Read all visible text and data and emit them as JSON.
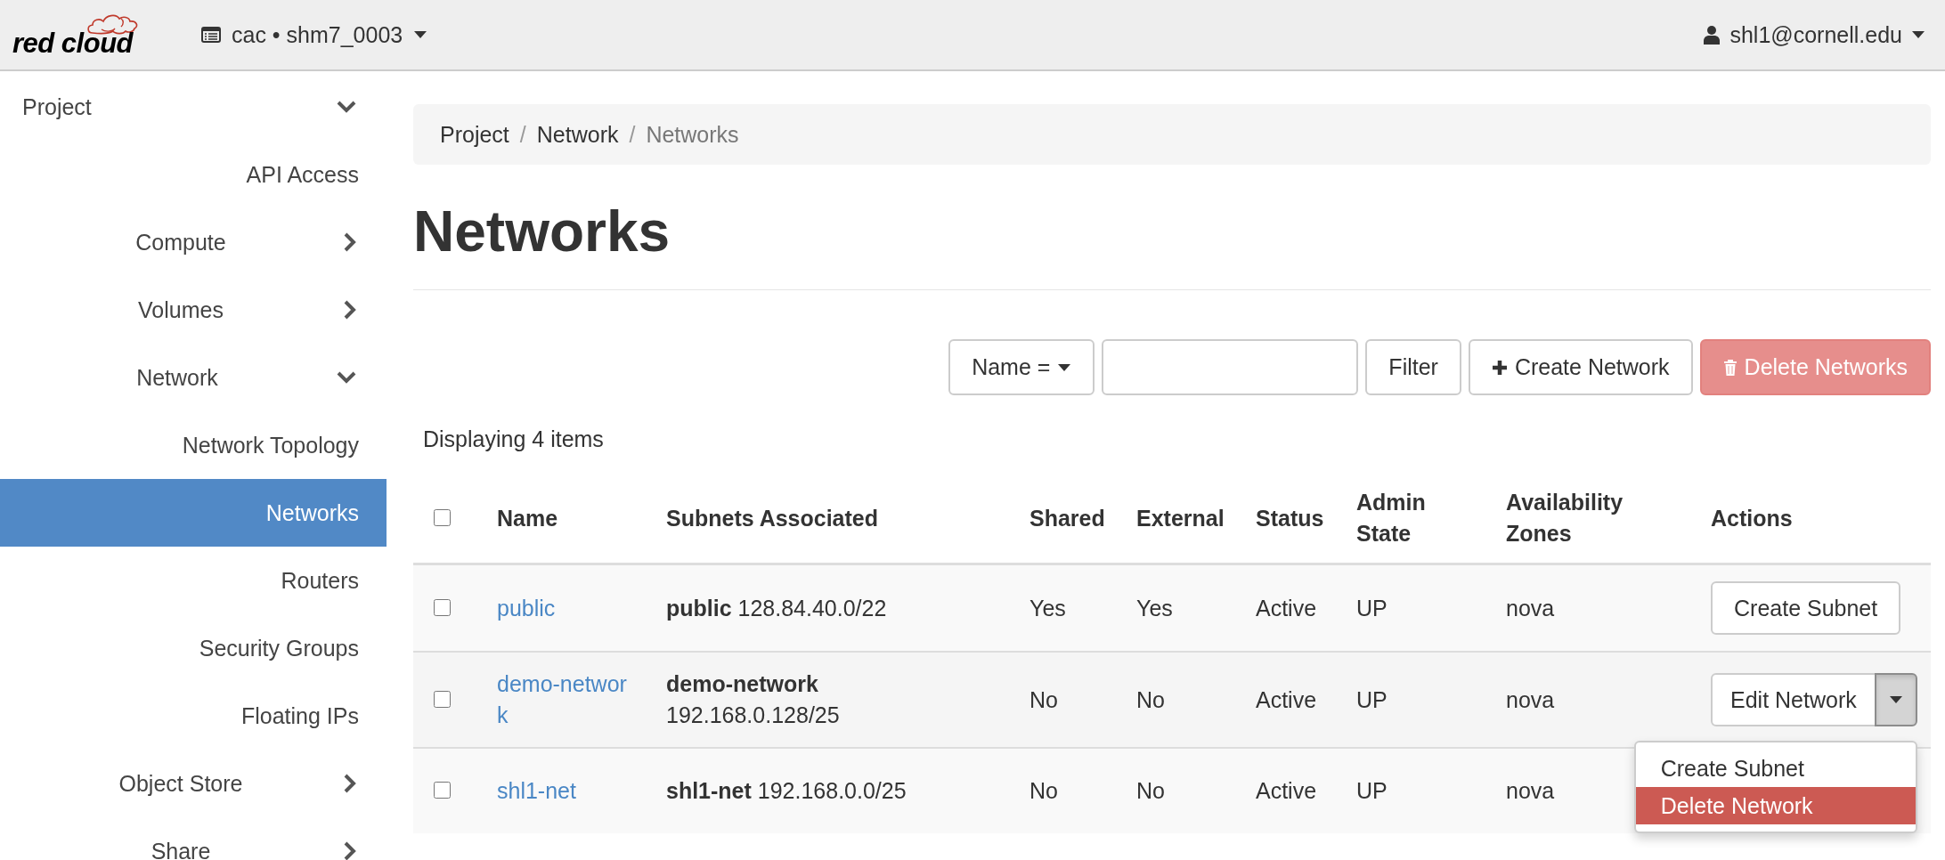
{
  "topbar": {
    "logo": "red cloud",
    "project": "cac • shm7_0003",
    "user": "shl1@cornell.edu"
  },
  "sidebar": {
    "items": [
      {
        "label": "Project",
        "kind": "section",
        "expanded": true,
        "selected": false,
        "children": [
          {
            "label": "API Access",
            "kind": "link",
            "selected": false
          },
          {
            "label": "Compute",
            "kind": "group",
            "expanded": false,
            "selected": false
          },
          {
            "label": "Volumes",
            "kind": "group",
            "expanded": false,
            "selected": false
          },
          {
            "label": "Network",
            "kind": "group",
            "expanded": true,
            "selected": false,
            "children": [
              {
                "label": "Network Topology",
                "kind": "link",
                "selected": false
              },
              {
                "label": "Networks",
                "kind": "link",
                "selected": true
              },
              {
                "label": "Routers",
                "kind": "link",
                "selected": false
              },
              {
                "label": "Security Groups",
                "kind": "link",
                "selected": false
              },
              {
                "label": "Floating IPs",
                "kind": "link",
                "selected": false
              }
            ]
          },
          {
            "label": "Object Store",
            "kind": "group",
            "expanded": false,
            "selected": false
          },
          {
            "label": "Share",
            "kind": "group",
            "expanded": false,
            "selected": false
          }
        ]
      }
    ]
  },
  "breadcrumb": {
    "separator": "/",
    "items": [
      {
        "label": "Project",
        "current": false
      },
      {
        "label": "Network",
        "current": false
      },
      {
        "label": "Networks",
        "current": true
      }
    ]
  },
  "page_title": "Networks",
  "toolbar": {
    "filter_field": "Name =",
    "filter_button": "Filter",
    "create_button": "Create Network",
    "delete_button": {
      "label": "Delete Networks",
      "disabled": true
    }
  },
  "count_text": "Displaying 4 items",
  "table": {
    "header_checkbox": {
      "checked": false
    },
    "columns": [
      "Name",
      "Subnets Associated",
      "Shared",
      "External",
      "Status",
      "Admin State",
      "Availability Zones",
      "Actions"
    ],
    "rows": [
      {
        "checked": false,
        "name": "public",
        "subnets": "**public** 128.84.40.0/22",
        "shared": "Yes",
        "external": "Yes",
        "status": "Active",
        "admin_state": "UP",
        "zone": "nova",
        "action": {
          "kind": "button",
          "label": "Create Subnet"
        }
      },
      {
        "checked": false,
        "name": "demo-network",
        "subnets": "**demo-network** 192.168.0.128/25",
        "shared": "No",
        "external": "No",
        "status": "Active",
        "admin_state": "UP",
        "zone": "nova",
        "action": {
          "kind": "split",
          "label": "Edit Network",
          "menu_open": true,
          "menu": [
            {
              "label": "Create Subnet",
              "selected": false
            },
            {
              "label": "Delete Network",
              "selected": true
            }
          ]
        }
      },
      {
        "checked": false,
        "name": "shl1-net",
        "subnets": "**shl1-net** 192.168.0.0/25",
        "shared": "No",
        "external": "No",
        "status": "Active",
        "admin_state": "UP",
        "zone": "nova"
      }
    ]
  }
}
